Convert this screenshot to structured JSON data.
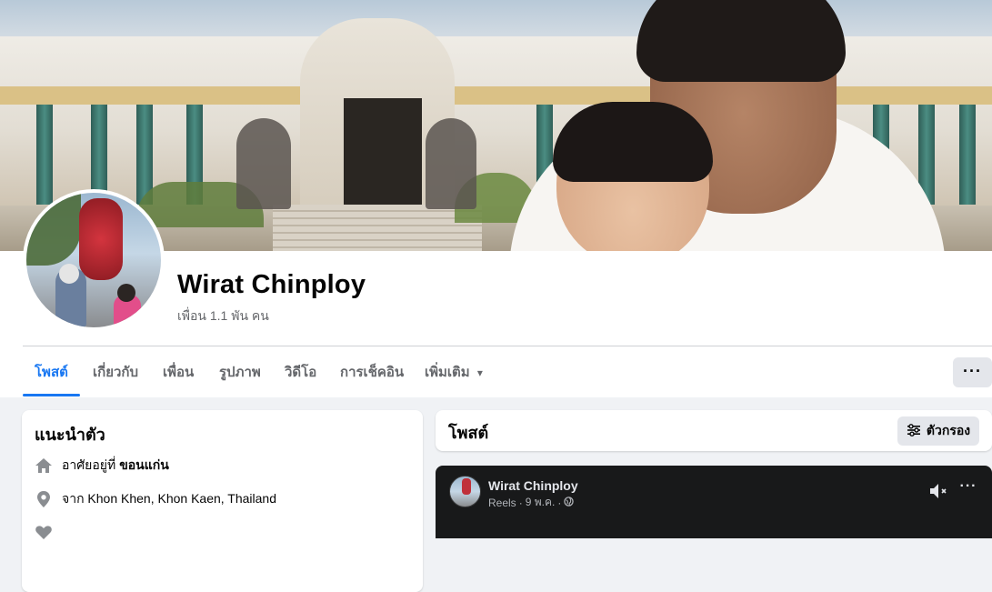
{
  "profile": {
    "name": "Wirat Chinploy",
    "friends": "เพื่อน 1.1 พัน คน"
  },
  "tabs": [
    {
      "label": "โพสต์",
      "active": true
    },
    {
      "label": "เกี่ยวกับ"
    },
    {
      "label": "เพื่อน"
    },
    {
      "label": "รูปภาพ"
    },
    {
      "label": "วิดีโอ"
    },
    {
      "label": "การเช็คอิน"
    },
    {
      "label": "เพิ่มเติม"
    }
  ],
  "tab_more_chevron": "▾",
  "more_button_label": "···",
  "intro": {
    "title": "แนะนำตัว",
    "items": [
      {
        "icon": "home-icon",
        "prefix": "อาศัยอยู่ที่",
        "bold": "ขอนแก่น"
      },
      {
        "icon": "location-pin-icon",
        "prefix": "จาก Khon Khen, Khon Kaen, Thailand",
        "bold": ""
      }
    ]
  },
  "posts": {
    "title": "โพสต์",
    "filter_label": "ตัวกรอง"
  },
  "post": {
    "author": "Wirat Chinploy",
    "type": "Reels",
    "separator": "·",
    "date": "9 พ.ค.",
    "more_label": "···"
  },
  "colors": {
    "accent": "#1877f2",
    "secondary_text": "#65676b",
    "page_bg": "#f0f2f5",
    "dark_card": "#18191a"
  }
}
